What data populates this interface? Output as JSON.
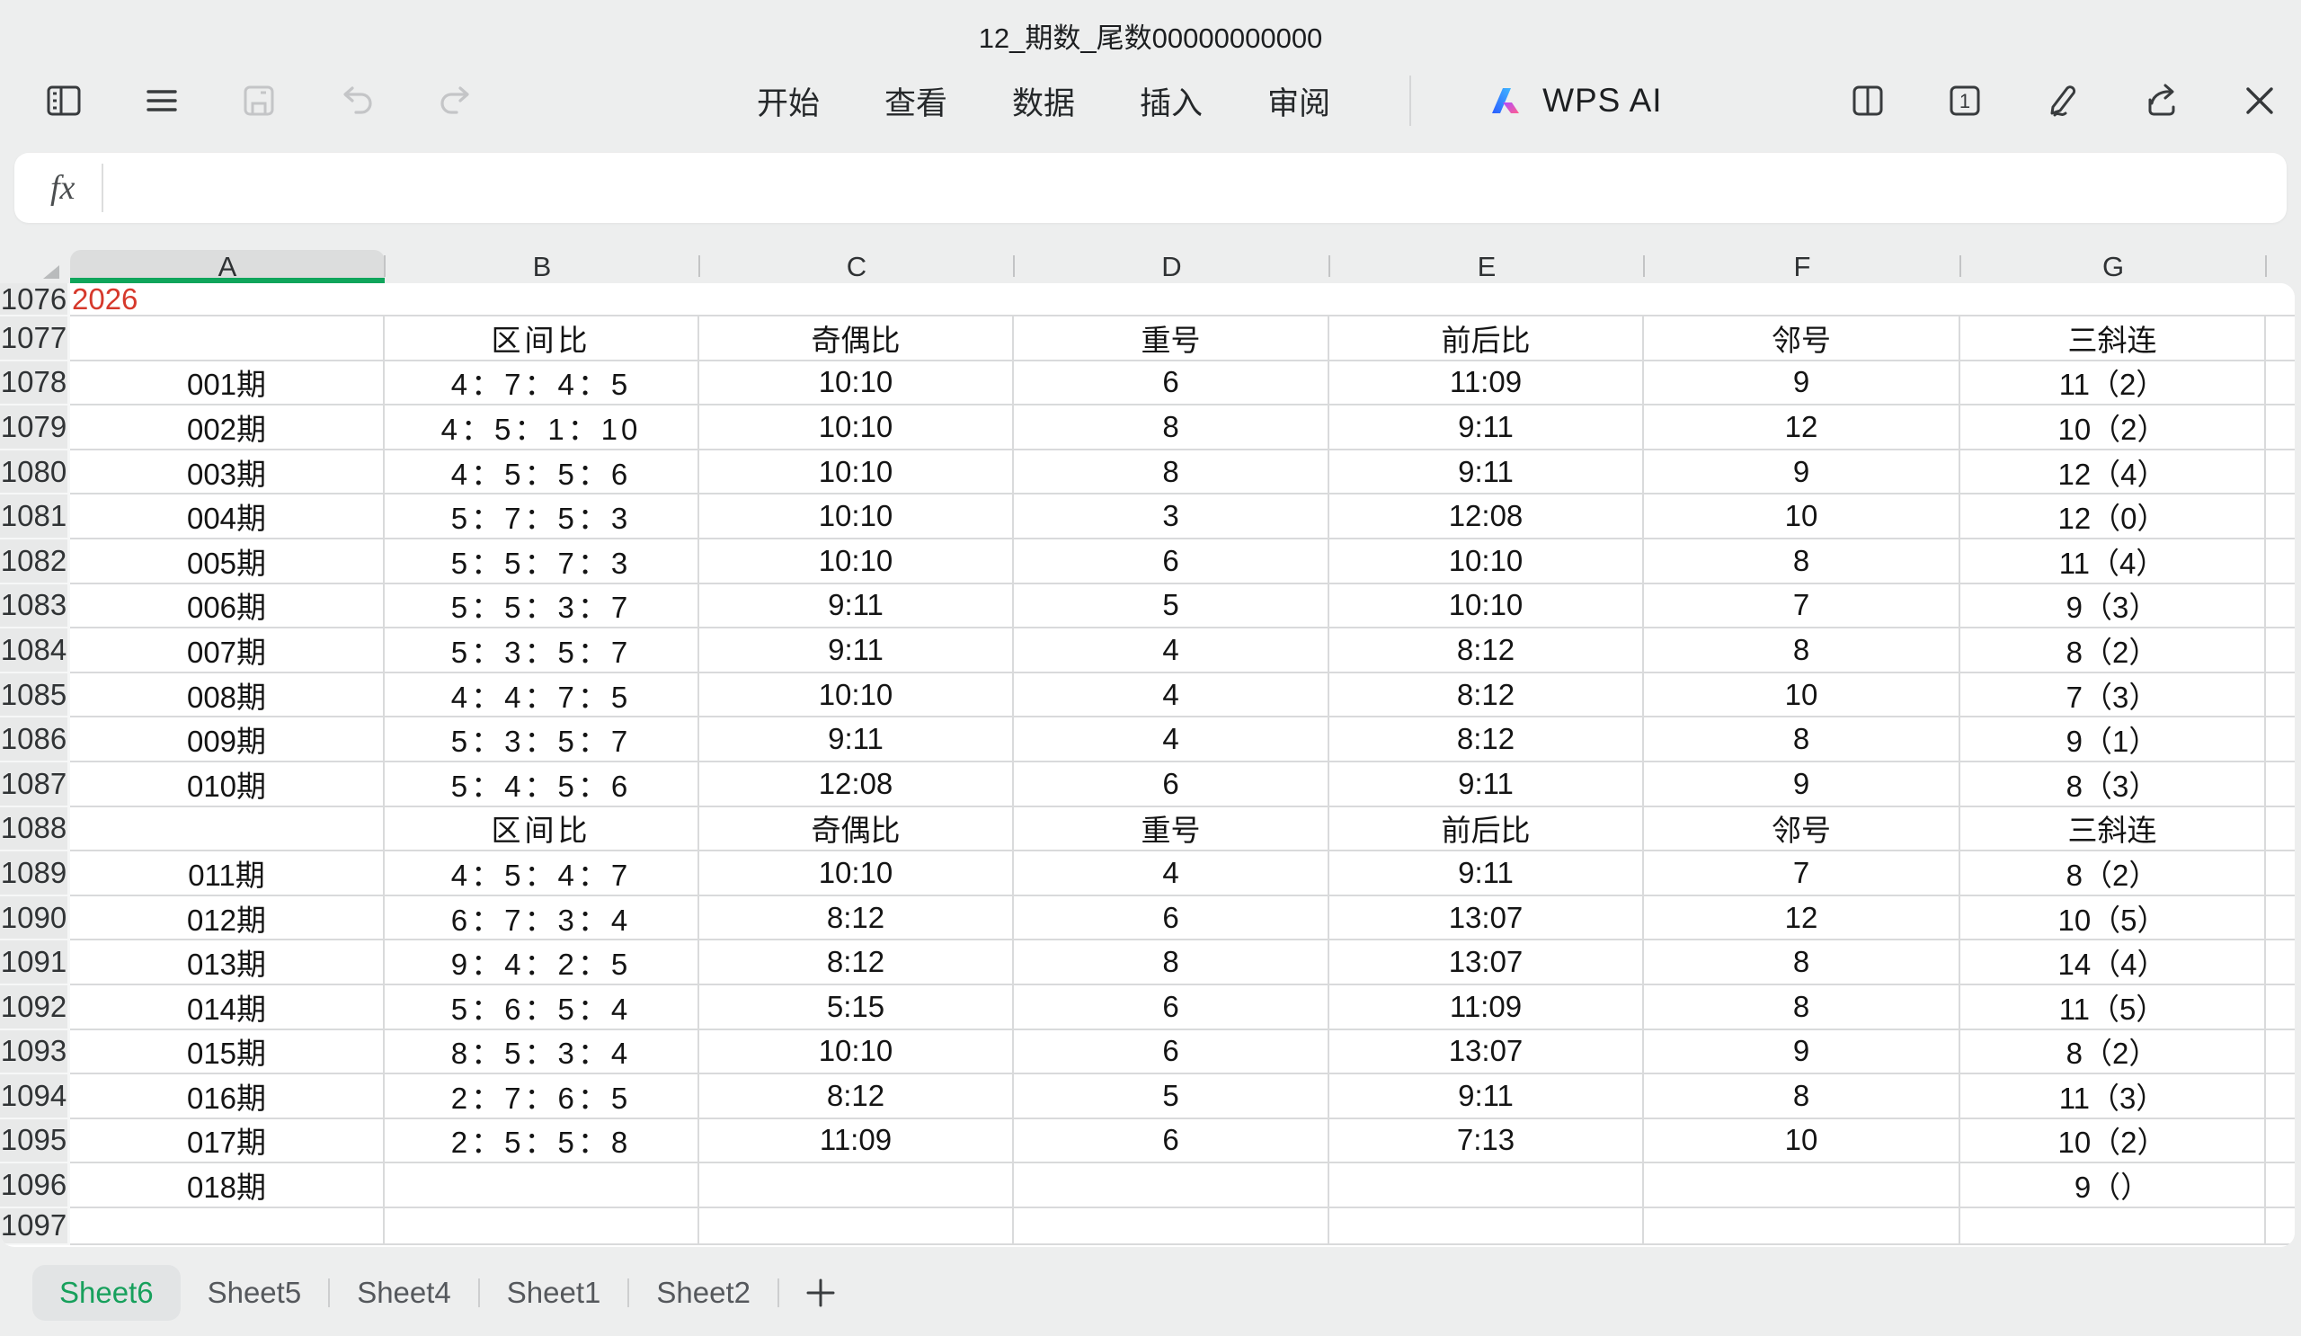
{
  "window": {
    "title": "12_期数_尾数00000000000"
  },
  "toolbar": {
    "icons_left": [
      "panel-toggle-icon",
      "hamburger-menu-icon",
      "save-icon",
      "undo-icon",
      "redo-icon"
    ],
    "menus": [
      "开始",
      "查看",
      "数据",
      "插入",
      "审阅"
    ],
    "wps_ai_label": "WPS AI",
    "icons_right": [
      "split-view-icon",
      "window-count-icon",
      "ink-pen-icon",
      "share-icon",
      "close-icon"
    ],
    "window_count": "1"
  },
  "formula_bar": {
    "fx_label": "fx",
    "value": ""
  },
  "grid": {
    "selected_column": "A",
    "columns": [
      "A",
      "B",
      "C",
      "D",
      "E",
      "F",
      "G"
    ],
    "rows": [
      {
        "n": "1076",
        "a": "2026",
        "b": "",
        "c": "",
        "d": "",
        "e": "",
        "f": "",
        "g": ""
      },
      {
        "n": "1077",
        "a": "",
        "b": "区间比",
        "c": "奇偶比",
        "d": "重号",
        "e": "前后比",
        "f": "邻号",
        "g": "三斜连"
      },
      {
        "n": "1078",
        "a": "001期",
        "b": "4：7：4：5",
        "c": "10:10",
        "d": "6",
        "e": "11:09",
        "f": "9",
        "g": "11（2）"
      },
      {
        "n": "1079",
        "a": "002期",
        "b": "4：5：1：10",
        "c": "10:10",
        "d": "8",
        "e": "9:11",
        "f": "12",
        "g": "10（2）"
      },
      {
        "n": "1080",
        "a": "003期",
        "b": "4：5：5：6",
        "c": "10:10",
        "d": "8",
        "e": "9:11",
        "f": "9",
        "g": "12（4）"
      },
      {
        "n": "1081",
        "a": "004期",
        "b": "5：7：5：3",
        "c": "10:10",
        "d": "3",
        "e": "12:08",
        "f": "10",
        "g": "12（0）"
      },
      {
        "n": "1082",
        "a": "005期",
        "b": "5：5：7：3",
        "c": "10:10",
        "d": "6",
        "e": "10:10",
        "f": "8",
        "g": "11（4）"
      },
      {
        "n": "1083",
        "a": "006期",
        "b": "5：5：3：7",
        "c": "9:11",
        "d": "5",
        "e": "10:10",
        "f": "7",
        "g": "9（3）"
      },
      {
        "n": "1084",
        "a": "007期",
        "b": "5：3：5：7",
        "c": "9:11",
        "d": "4",
        "e": "8:12",
        "f": "8",
        "g": "8（2）"
      },
      {
        "n": "1085",
        "a": "008期",
        "b": "4：4：7：5",
        "c": "10:10",
        "d": "4",
        "e": "8:12",
        "f": "10",
        "g": "7（3）"
      },
      {
        "n": "1086",
        "a": "009期",
        "b": "5：3：5：7",
        "c": "9:11",
        "d": "4",
        "e": "8:12",
        "f": "8",
        "g": "9（1）"
      },
      {
        "n": "1087",
        "a": "010期",
        "b": "5：4：5：6",
        "c": "12:08",
        "d": "6",
        "e": "9:11",
        "f": "9",
        "g": "8（3）"
      },
      {
        "n": "1088",
        "a": "",
        "b": "区间比",
        "c": "奇偶比",
        "d": "重号",
        "e": "前后比",
        "f": "邻号",
        "g": "三斜连"
      },
      {
        "n": "1089",
        "a": "011期",
        "b": "4：5：4：7",
        "c": "10:10",
        "d": "4",
        "e": "9:11",
        "f": "7",
        "g": "8（2）"
      },
      {
        "n": "1090",
        "a": "012期",
        "b": "6：7：3：4",
        "c": "8:12",
        "d": "6",
        "e": "13:07",
        "f": "12",
        "g": "10（5）"
      },
      {
        "n": "1091",
        "a": "013期",
        "b": "9：4：2：5",
        "c": "8:12",
        "d": "8",
        "e": "13:07",
        "f": "8",
        "g": "14（4）"
      },
      {
        "n": "1092",
        "a": "014期",
        "b": "5：6：5：4",
        "c": "5:15",
        "d": "6",
        "e": "11:09",
        "f": "8",
        "g": "11（5）"
      },
      {
        "n": "1093",
        "a": "015期",
        "b": "8：5：3：4",
        "c": "10:10",
        "d": "6",
        "e": "13:07",
        "f": "9",
        "g": "8（2）"
      },
      {
        "n": "1094",
        "a": "016期",
        "b": "2：7：6：5",
        "c": "8:12",
        "d": "5",
        "e": "9:11",
        "f": "8",
        "g": "11（3）"
      },
      {
        "n": "1095",
        "a": "017期",
        "b": "2：5：5：8",
        "c": "11:09",
        "d": "6",
        "e": "7:13",
        "f": "10",
        "g": "10（2）"
      },
      {
        "n": "1096",
        "a": "018期",
        "b": "",
        "c": "",
        "d": "",
        "e": "",
        "f": "",
        "g": "9（）"
      },
      {
        "n": "1097",
        "a": "",
        "b": "",
        "c": "",
        "d": "",
        "e": "",
        "f": "",
        "g": ""
      }
    ]
  },
  "sheet_tabs": {
    "active": "Sheet6",
    "tabs": [
      "Sheet6",
      "Sheet5",
      "Sheet4",
      "Sheet1",
      "Sheet2"
    ],
    "add_label": "+"
  },
  "colors": {
    "accent_green": "#0fa55b",
    "active_tab_green": "#17a05c",
    "alert_red": "#d6392c",
    "disabled_icon": "#c4c5c7",
    "grid_line": "#d9dadb"
  }
}
